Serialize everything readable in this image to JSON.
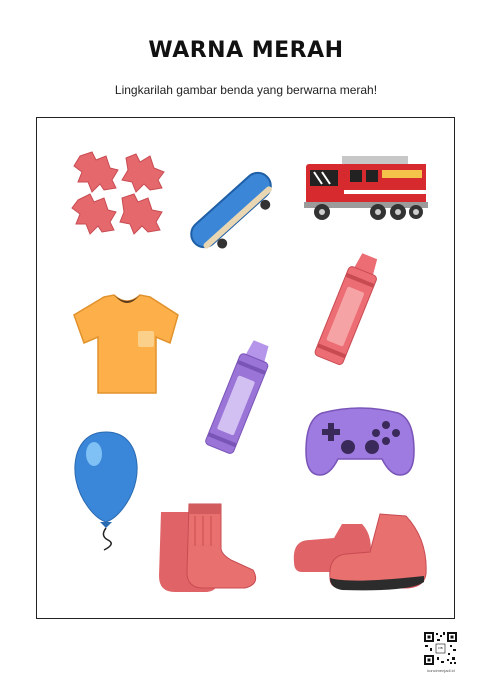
{
  "worksheet": {
    "title": "WARNA MERAH",
    "instruction": "Lingkarilah gambar benda yang berwarna merah!"
  },
  "items": [
    {
      "name": "puzzle-pieces",
      "color": "#e4686c"
    },
    {
      "name": "skateboard",
      "color": "#3b86d6"
    },
    {
      "name": "fire-truck",
      "color": "#d62a2f"
    },
    {
      "name": "t-shirt",
      "color": "#fdb04a"
    },
    {
      "name": "red-crayon",
      "color": "#ec6d73"
    },
    {
      "name": "purple-crayon",
      "color": "#9a74d6"
    },
    {
      "name": "game-controller",
      "color": "#9d7be0"
    },
    {
      "name": "balloon",
      "color": "#3a86d9"
    },
    {
      "name": "socks",
      "color": "#e8706f"
    },
    {
      "name": "shoes",
      "color": "#e8706f"
    }
  ],
  "footer": {
    "qr_center_label": "DB",
    "qr_caption": "kuncimenjadi.id"
  }
}
